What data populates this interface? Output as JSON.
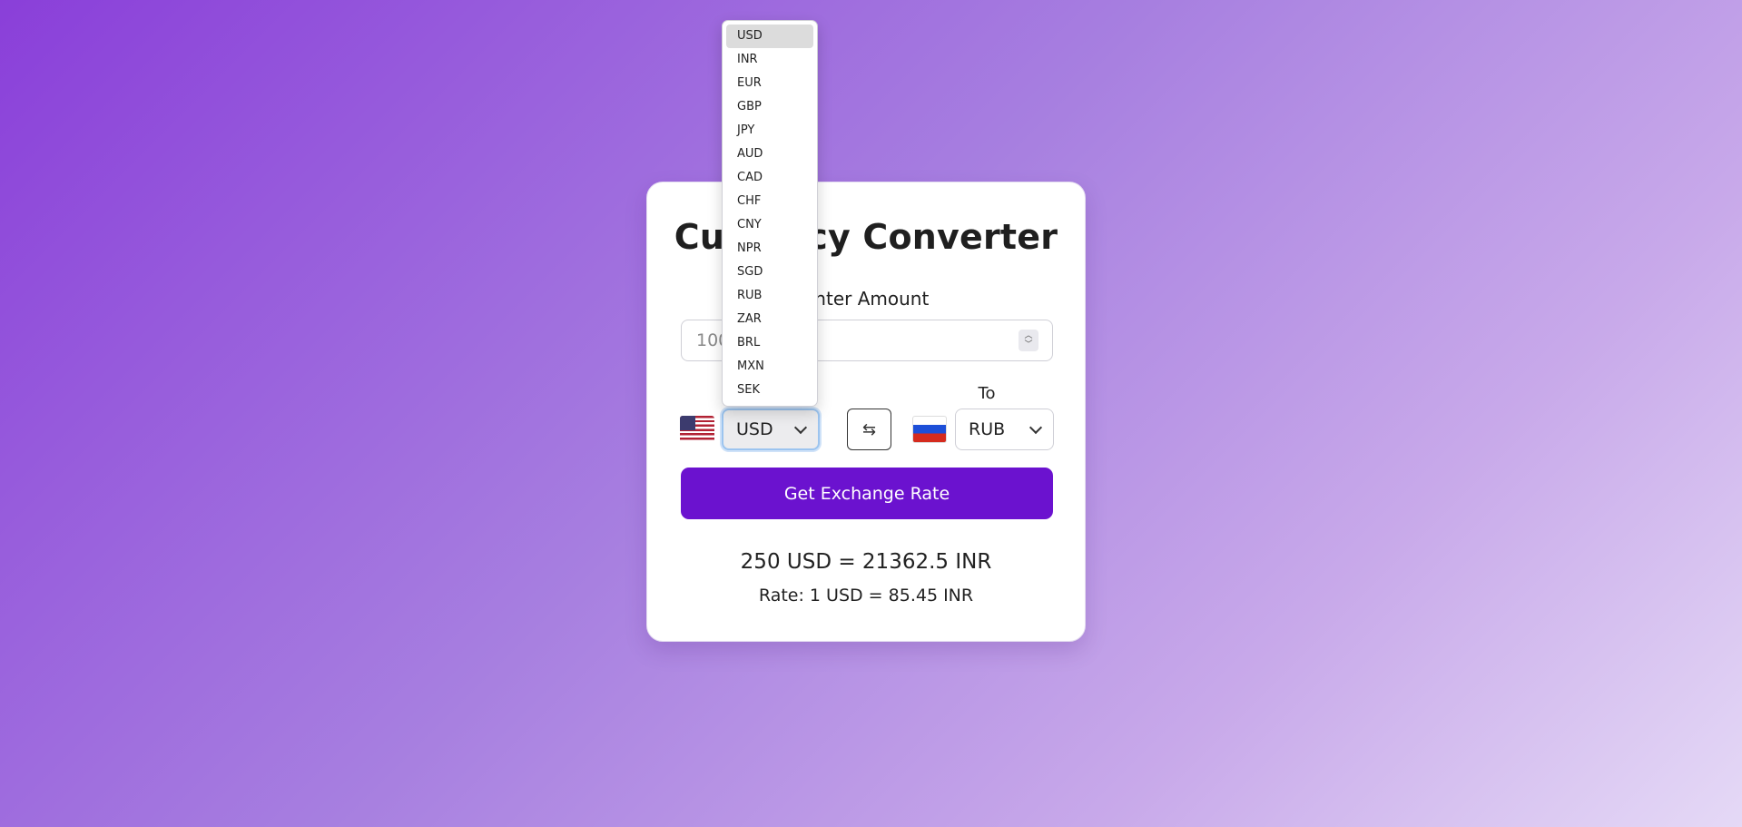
{
  "app": {
    "title": "Currency Converter"
  },
  "amount": {
    "label": "Enter Amount",
    "placeholder": "100"
  },
  "from": {
    "selected": "USD",
    "flag": "us-flag"
  },
  "to": {
    "label": "To",
    "selected": "RUB",
    "flag": "ru-flag"
  },
  "swap": {
    "label": "⇆"
  },
  "button": {
    "label": "Get Exchange Rate"
  },
  "result": {
    "conversion": "250 USD = 21362.5 INR",
    "rate": "Rate: 1 USD = 85.45 INR"
  },
  "dropdown": {
    "options": [
      "USD",
      "INR",
      "EUR",
      "GBP",
      "JPY",
      "AUD",
      "CAD",
      "CHF",
      "CNY",
      "NPR",
      "SGD",
      "RUB",
      "ZAR",
      "BRL",
      "MXN",
      "SEK"
    ],
    "highlighted_index": 0
  },
  "colors": {
    "accent": "#6b12cf",
    "background_start": "#8a3fd9",
    "background_end": "#e5d9f6"
  }
}
